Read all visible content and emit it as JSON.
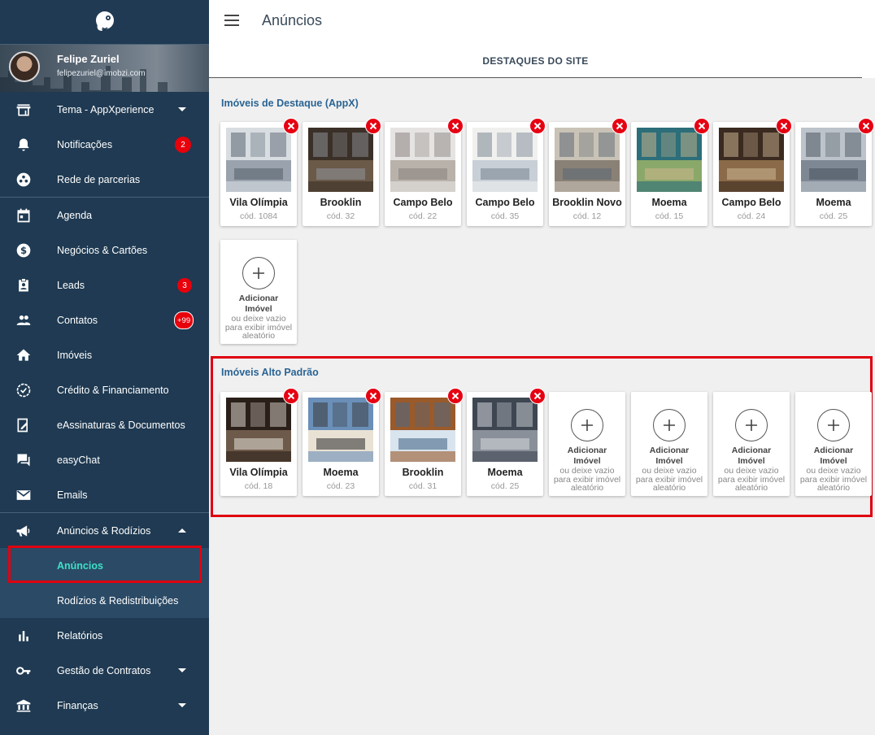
{
  "app": {
    "brand_color": "#1f3a52",
    "accent": "#3de0c8",
    "highlight_color": "#e0000f"
  },
  "user": {
    "name": "Felipe Zuriel",
    "email": "felipezuriel@imobzi.com"
  },
  "sidebar": {
    "items": [
      {
        "label": "Tema - AppXperience",
        "icon": "store-icon",
        "caret": "down"
      },
      {
        "label": "Notificações",
        "icon": "bell-icon",
        "badge": "2"
      },
      {
        "label": "Rede de parcerias",
        "icon": "network-icon"
      },
      {
        "label": "Agenda",
        "icon": "calendar-icon"
      },
      {
        "label": "Negócios & Cartões",
        "icon": "dollar-icon"
      },
      {
        "label": "Leads",
        "icon": "clipboard-user-icon",
        "badge": "3"
      },
      {
        "label": "Contatos",
        "icon": "people-icon",
        "badge": "+99"
      },
      {
        "label": "Imóveis",
        "icon": "home-icon"
      },
      {
        "label": "Crédito & Financiamento",
        "icon": "verified-badge-icon"
      },
      {
        "label": "eAssinaturas & Documentos",
        "icon": "sign-document-icon"
      },
      {
        "label": "easyChat",
        "icon": "chat-icon"
      },
      {
        "label": "Emails",
        "icon": "mail-icon"
      },
      {
        "label": "Anúncios & Rodízios",
        "icon": "megaphone-icon",
        "caret": "up"
      },
      {
        "label": "Relatórios",
        "icon": "bar-chart-icon"
      },
      {
        "label": "Gestão de Contratos",
        "icon": "key-icon",
        "caret": "down"
      },
      {
        "label": "Finanças",
        "icon": "bank-icon",
        "caret": "down"
      }
    ],
    "sub_items": [
      {
        "label": "Anúncios",
        "active": true
      },
      {
        "label": "Rodízios & Redistribuições",
        "active": false
      }
    ]
  },
  "header": {
    "title": "Anúncios",
    "tab": "DESTAQUES DO SITE"
  },
  "sections": [
    {
      "title": "Imóveis de Destaque (AppX)",
      "cards": [
        {
          "name": "Vila Olímpia",
          "code": "cód. 1084"
        },
        {
          "name": "Brooklin",
          "code": "cód. 32"
        },
        {
          "name": "Campo Belo",
          "code": "cód. 22"
        },
        {
          "name": "Campo Belo",
          "code": "cód. 35"
        },
        {
          "name": "Brooklin Novo",
          "code": "cód. 12"
        },
        {
          "name": "Moema",
          "code": "cód. 15"
        },
        {
          "name": "Campo Belo",
          "code": "cód. 24"
        },
        {
          "name": "Moema",
          "code": "cód. 25"
        }
      ],
      "add_slots": 1
    },
    {
      "title": "Imóveis Alto Padrão",
      "cards": [
        {
          "name": "Vila Olímpia",
          "code": "cód. 18"
        },
        {
          "name": "Moema",
          "code": "cód. 23"
        },
        {
          "name": "Brooklin",
          "code": "cód. 31"
        },
        {
          "name": "Moema",
          "code": "cód. 25"
        }
      ],
      "add_slots": 4
    }
  ],
  "add_card": {
    "title": "Adicionar Imóvel",
    "subtitle": "ou deixe vazio para exibir imóvel aleatório"
  }
}
